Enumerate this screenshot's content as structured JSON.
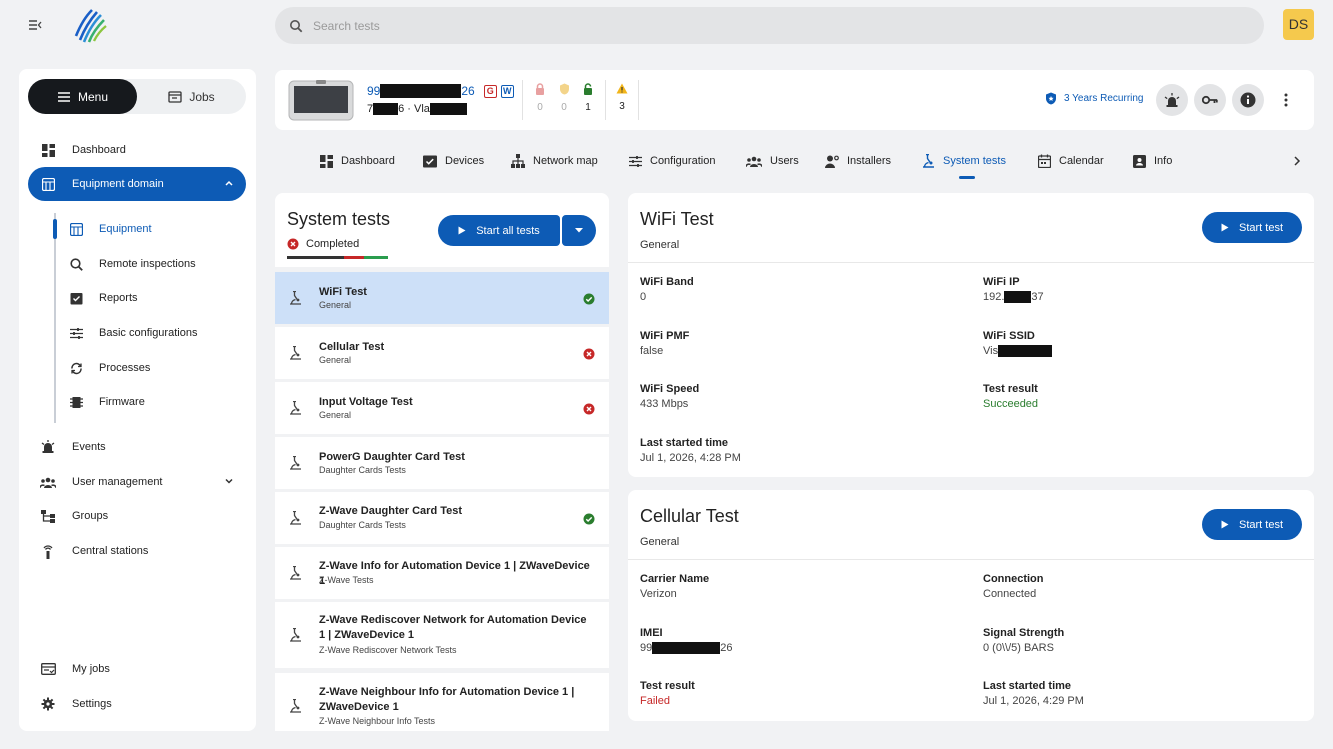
{
  "search": {
    "placeholder": "Search tests"
  },
  "user": {
    "initials": "DS"
  },
  "sidebar": {
    "toggle": {
      "menu_label": "Menu",
      "jobs_label": "Jobs"
    },
    "items": {
      "dashboard": "Dashboard",
      "equipment_domain": "Equipment domain",
      "events": "Events",
      "user_management": "User management",
      "groups": "Groups",
      "central_stations": "Central stations",
      "my_jobs": "My jobs",
      "settings": "Settings"
    },
    "sub_items": {
      "equipment": "Equipment",
      "remote_inspections": "Remote inspections",
      "reports": "Reports",
      "basic_configurations": "Basic configurations",
      "processes": "Processes",
      "firmware": "Firmware"
    }
  },
  "device": {
    "id_prefix": "99",
    "id_suffix": "26",
    "badge_g": "G",
    "badge_w": "W",
    "line2_prefix": "7",
    "line2_mid": "6 · Vla",
    "stats": {
      "alarm_locked": "0",
      "alarm_open": "0",
      "unlocked": "1",
      "warnings": "3"
    },
    "subscription": "3 Years Recurring"
  },
  "tabs": [
    "Dashboard",
    "Devices",
    "Network map",
    "Configuration",
    "Users",
    "Installers",
    "System tests",
    "Calendar",
    "Info"
  ],
  "tests_panel": {
    "title": "System tests",
    "status": "Completed",
    "start_all_label": "Start all tests",
    "items": [
      {
        "name": "WiFi Test",
        "category": "General",
        "status": "passed"
      },
      {
        "name": "Cellular Test",
        "category": "General",
        "status": "failed"
      },
      {
        "name": "Input Voltage Test",
        "category": "General",
        "status": "failed"
      },
      {
        "name": "PowerG Daughter Card Test",
        "category": "Daughter Cards Tests",
        "status": "none"
      },
      {
        "name": "Z-Wave Daughter Card Test",
        "category": "Daughter Cards Tests",
        "status": "passed"
      },
      {
        "name": "Z-Wave Info for Automation Device 1 | ZWaveDevice 1",
        "category": "Z-Wave Tests",
        "status": "none"
      },
      {
        "name": "Z-Wave Rediscover Network for Automation Device 1 | ZWaveDevice 1",
        "category": "Z-Wave Rediscover Network Tests",
        "status": "none"
      },
      {
        "name": "Z-Wave Neighbour Info for Automation Device 1 | ZWaveDevice 1",
        "category": "Z-Wave Neighbour Info Tests",
        "status": "none"
      }
    ]
  },
  "wifi_card": {
    "title": "WiFi Test",
    "subtitle": "General",
    "start_label": "Start test",
    "fields": {
      "band_label": "WiFi Band",
      "band_value": "0",
      "ip_label": "WiFi IP",
      "ip_prefix": "192.",
      "ip_suffix": "37",
      "pmf_label": "WiFi PMF",
      "pmf_value": "false",
      "ssid_label": "WiFi SSID",
      "ssid_prefix": "Vis",
      "speed_label": "WiFi Speed",
      "speed_value": "433 Mbps",
      "result_label": "Test result",
      "result_value": "Succeeded",
      "started_label": "Last started time",
      "started_value": "Jul 1, 2026, 4:28 PM"
    }
  },
  "cellular_card": {
    "title": "Cellular Test",
    "subtitle": "General",
    "start_label": "Start test",
    "fields": {
      "carrier_label": "Carrier Name",
      "carrier_value": "Verizon",
      "connection_label": "Connection",
      "connection_value": "Connected",
      "imei_label": "IMEI",
      "imei_prefix": "99",
      "imei_suffix": "26",
      "signal_label": "Signal Strength",
      "signal_value": "0 (0\\\\/5) BARS",
      "result_label": "Test result",
      "result_value": "Failed",
      "started_label": "Last started time",
      "started_value": "Jul 1, 2026, 4:29 PM"
    }
  },
  "colors": {
    "accent": "#0d5bb5",
    "success": "#2a7d2e",
    "error": "#c62828",
    "selected_row": "#cde0f8",
    "avatar": "#f5c94d"
  }
}
